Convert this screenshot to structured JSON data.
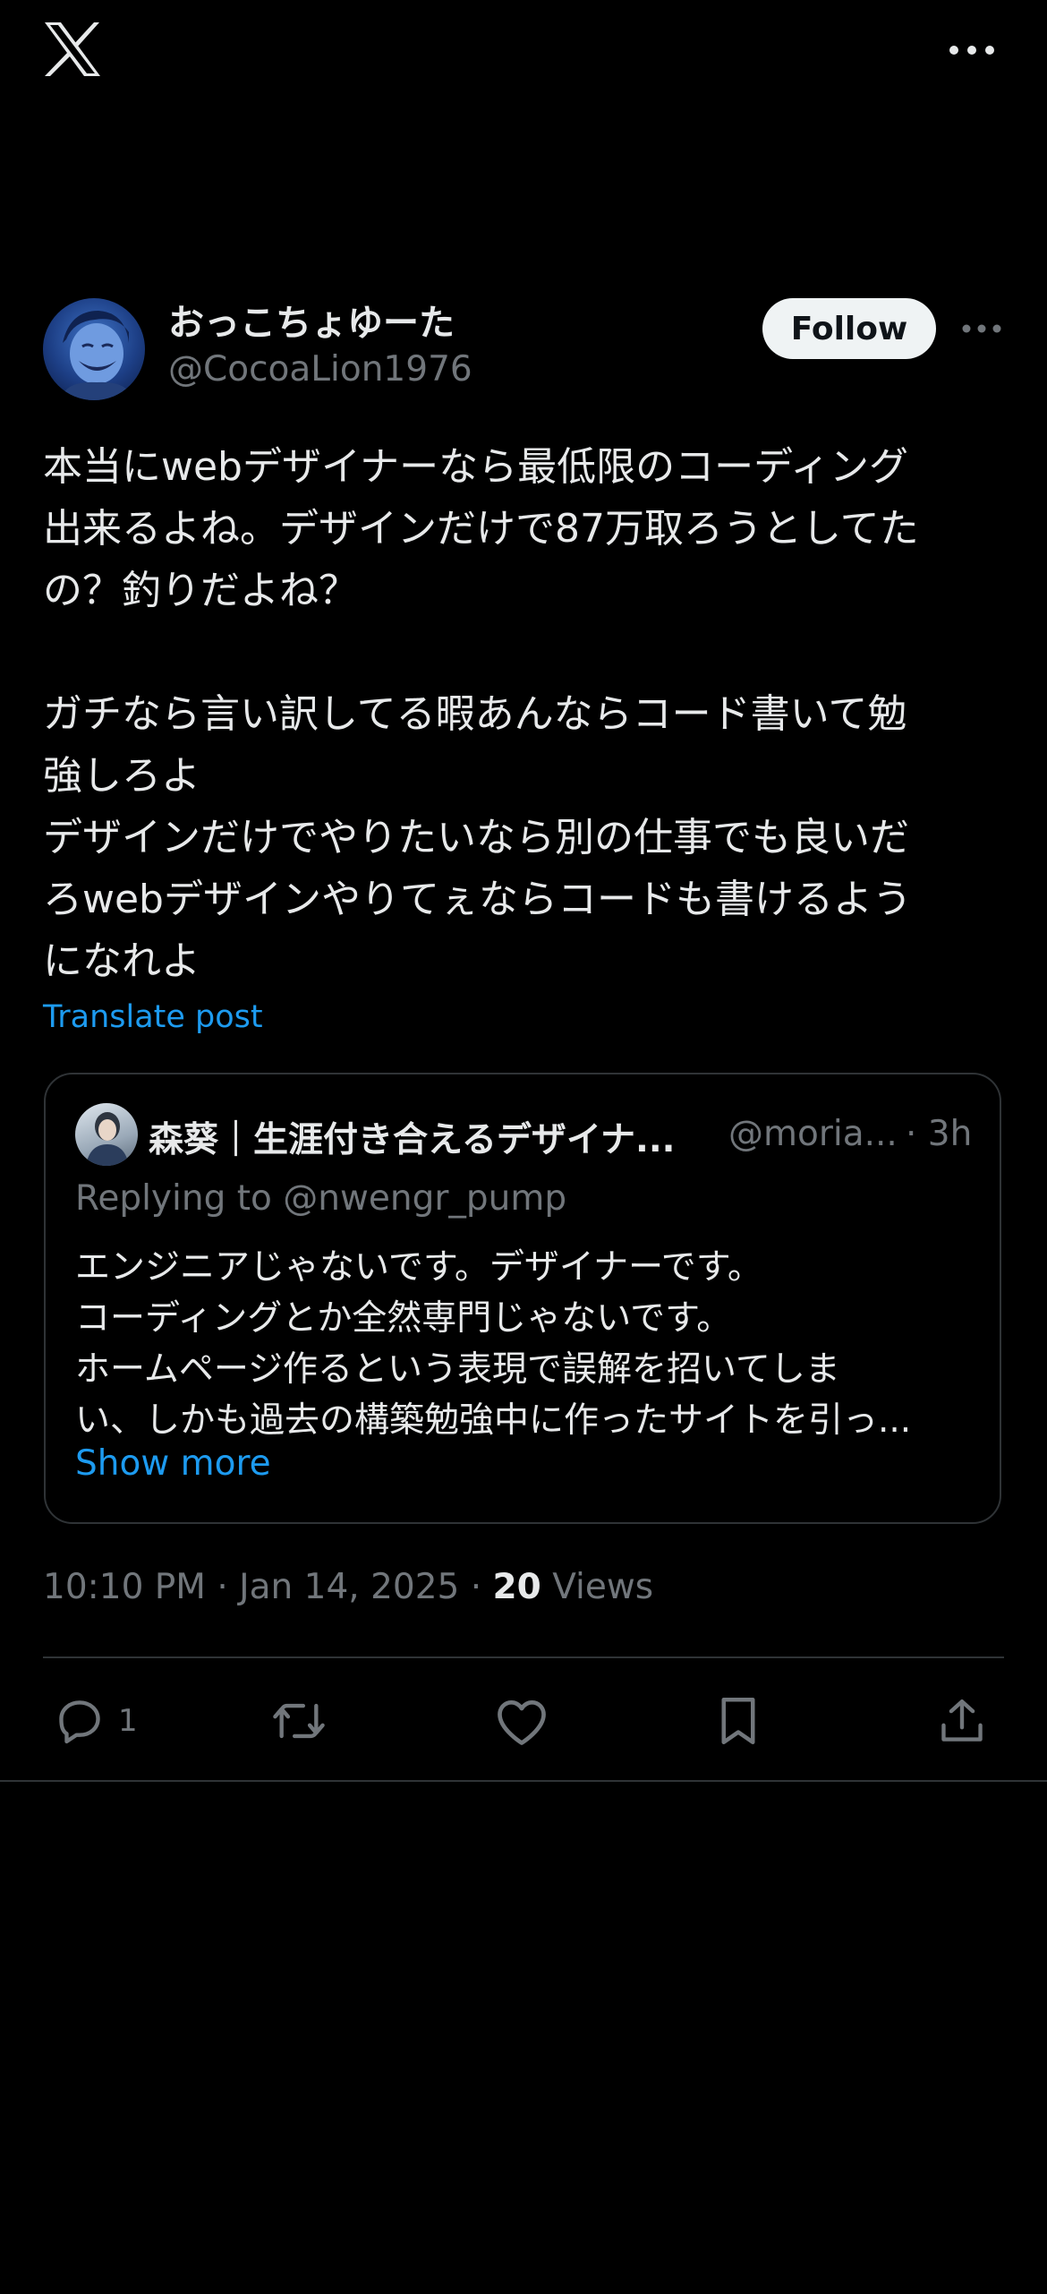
{
  "top_bar": {
    "logo_icon": "x-logo-icon",
    "more_icon": "more-horizontal-icon"
  },
  "author": {
    "display_name": "おっこちょゆーた",
    "handle": "@CocoaLion1976",
    "follow_label": "Follow"
  },
  "post": {
    "text": "本当にwebデザイナーなら最低限のコーディング\n出来るよね。デザインだけで87万取ろうとしてた\nの？釣りだよね？\n\nガチなら言い訳してる暇あんならコード書いて勉\n強しろよ\nデザインだけでやりたいなら別の仕事でも良いだ\nろwebデザインやりてぇならコードも書けるよう\nになれよ",
    "translate_label": "Translate post",
    "time": "10:10 PM · Jan 14, 2025 · ",
    "views_count": "20",
    "views_label": " Views"
  },
  "quote": {
    "name": "森葵｜生涯付き合えるデザイナ...",
    "handle": "@moria...",
    "time": "· 3h",
    "replying_to": "Replying to @nwengr_pump",
    "lines": [
      "エンジニアじゃないです。デザイナーです。",
      "コーディングとか全然専門じゃないです。",
      "ホームページ作るという表現で誤解を招いてしま",
      "い、しかも過去の構築勉強中に作ったサイトを引っ..."
    ],
    "show_more": "Show more"
  },
  "actions": {
    "reply_count": "1",
    "icons": [
      "reply-icon",
      "repost-icon",
      "like-icon",
      "bookmark-icon",
      "share-icon"
    ]
  },
  "colors": {
    "background": "#000000",
    "text": "#e7e9ea",
    "secondary": "#71767b",
    "link": "#1d9bf0",
    "divider": "#2f3336"
  }
}
